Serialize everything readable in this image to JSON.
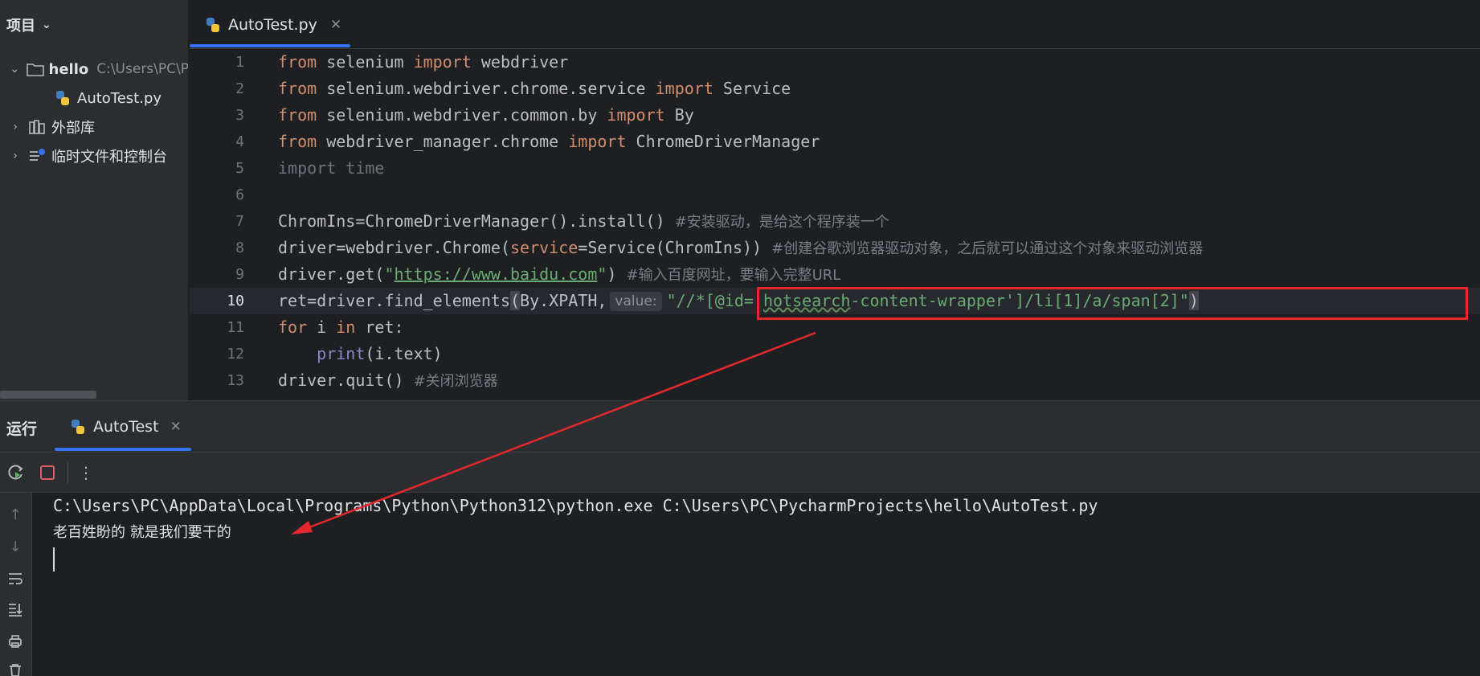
{
  "sidebar": {
    "title": "项目",
    "project": {
      "name": "hello",
      "path": "C:\\Users\\PC\\P"
    },
    "file": "AutoTest.py",
    "items": [
      "外部库",
      "临时文件和控制台"
    ]
  },
  "editor": {
    "tab": {
      "label": "AutoTest.py"
    },
    "line_numbers": [
      "1",
      "2",
      "3",
      "4",
      "5",
      "6",
      "7",
      "8",
      "9",
      "10",
      "11",
      "12",
      "13"
    ],
    "code": {
      "l1": {
        "from": "from",
        "mod": " selenium ",
        "imp": "import",
        "name": " webdriver"
      },
      "l2": {
        "from": "from",
        "mod": " selenium.webdriver.chrome.service ",
        "imp": "import",
        "name": " Service"
      },
      "l3": {
        "from": "from",
        "mod": " selenium.webdriver.common.by ",
        "imp": "import",
        "name": " By"
      },
      "l4": {
        "from": "from",
        "mod": " webdriver_manager.chrome ",
        "imp": "import",
        "name": " ChromeDriverManager"
      },
      "l5": {
        "text": "import time"
      },
      "l7": {
        "code": "ChromIns=ChromeDriverManager().install() ",
        "comment": "#安装驱动，是给这个程序装一个"
      },
      "l8": {
        "pre": "driver=webdriver.Chrome(",
        "param": "service",
        "post": "=Service(ChromIns)) ",
        "comment": "#创建谷歌浏览器驱动对象，之后就可以通过这个对象来驱动浏览器"
      },
      "l9": {
        "pre": "driver.get(",
        "q1": "\"",
        "url": "https://www.baidu.com",
        "q2": "\"",
        "post": ") ",
        "comment": "#输入百度网址，要输入完整URL"
      },
      "l10": {
        "pre": "ret=driver.find_elements",
        "po": "(",
        "mid": "By.XPATH,",
        "hint": "value:",
        "s1": "\"//*[@id='",
        "wavy": "hotsearch",
        "s2": "-content-wrapper']/li[1]/a/span[2]\"",
        "pc": ")"
      },
      "l11": {
        "kw1": "for",
        "mid": " i ",
        "kw2": "in",
        "post": " ret:"
      },
      "l12": {
        "indent": "    ",
        "fn": "print",
        "post": "(i.text)"
      },
      "l13": {
        "code": "driver.quit() ",
        "comment": "#关闭浏览器"
      }
    }
  },
  "run": {
    "title": "运行",
    "tab": "AutoTest",
    "output": [
      "C:\\Users\\PC\\AppData\\Local\\Programs\\Python\\Python312\\python.exe C:\\Users\\PC\\PycharmProjects\\hello\\AutoTest.py",
      "老百姓盼的 就是我们要干的"
    ]
  },
  "colors": {
    "annotation_red": "#e2282d",
    "keyword": "#cf8e6d",
    "string": "#6aab73",
    "accent": "#3574f0"
  }
}
